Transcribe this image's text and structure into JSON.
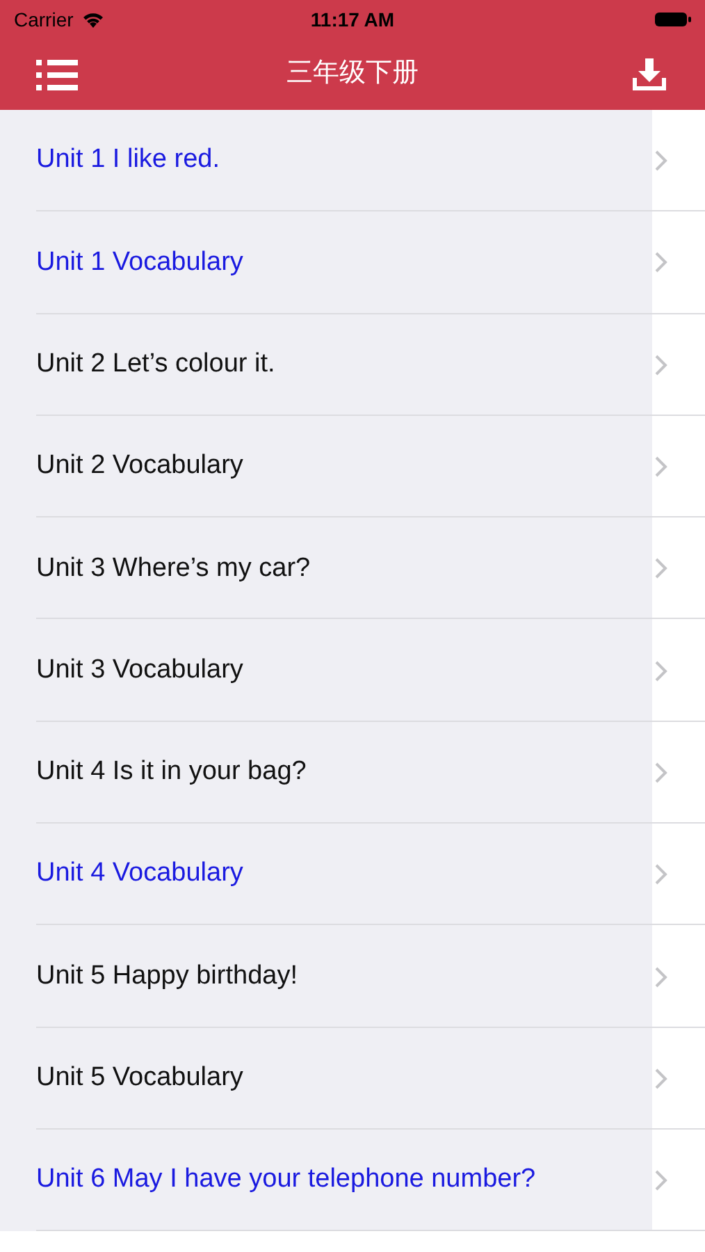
{
  "status_bar": {
    "carrier": "Carrier",
    "time": "11:17 AM"
  },
  "nav_bar": {
    "title": "三年级下册"
  },
  "lessons": [
    {
      "title": "Unit 1 I like red.",
      "highlighted": true
    },
    {
      "title": "Unit 1 Vocabulary",
      "highlighted": true
    },
    {
      "title": "Unit 2 Let’s colour it.",
      "highlighted": false
    },
    {
      "title": "Unit 2 Vocabulary",
      "highlighted": false
    },
    {
      "title": "Unit 3 Where’s my car?",
      "highlighted": false
    },
    {
      "title": "Unit 3 Vocabulary",
      "highlighted": false
    },
    {
      "title": "Unit 4 Is it in your bag?",
      "highlighted": false
    },
    {
      "title": "Unit 4 Vocabulary",
      "highlighted": true
    },
    {
      "title": "Unit 5 Happy birthday!",
      "highlighted": false
    },
    {
      "title": "Unit 5 Vocabulary",
      "highlighted": false
    },
    {
      "title": "Unit 6 May I have your telephone number?",
      "highlighted": true
    }
  ]
}
